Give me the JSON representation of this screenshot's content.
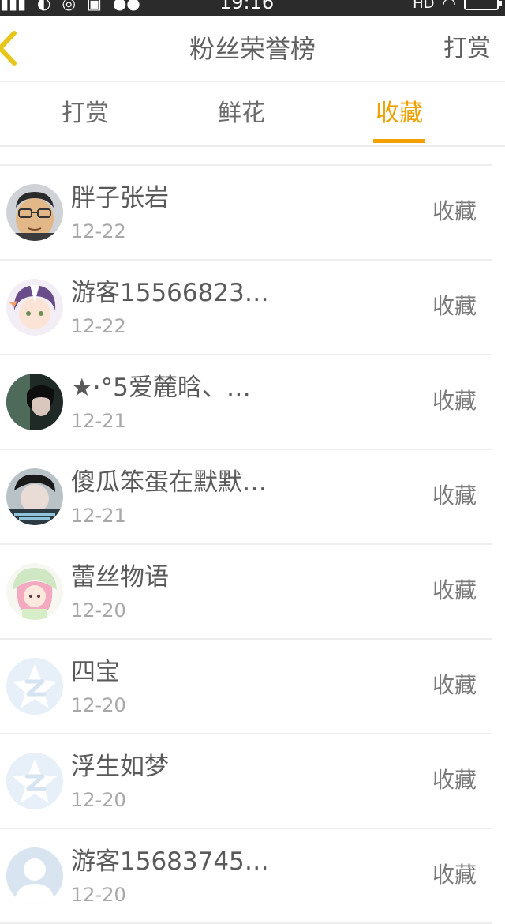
{
  "status_bar": {
    "time": "19:16",
    "network_label": "HD",
    "left_icons": [
      "signal-icon",
      "moon-icon",
      "location-icon",
      "sim-icon",
      "wechat-icon"
    ],
    "right_icons": [
      "wifi-icon",
      "battery-icon"
    ]
  },
  "navbar": {
    "title": "粉丝荣誉榜",
    "right_label": "打赏",
    "back_icon": "chevron-left-icon"
  },
  "tabs": [
    {
      "label": "打赏",
      "active": false
    },
    {
      "label": "鲜花",
      "active": false
    },
    {
      "label": "收藏",
      "active": true
    }
  ],
  "accent_color": "#f2a100",
  "list": [
    {
      "name": "胖子张岩",
      "date": "12-22",
      "action": "收藏",
      "avatar": "photo-avatar"
    },
    {
      "name": "游客15566823…",
      "date": "12-22",
      "action": "收藏",
      "avatar": "anime-avatar"
    },
    {
      "name": "★·°5爱麓晗、…",
      "date": "12-21",
      "action": "收藏",
      "avatar": "photo-avatar"
    },
    {
      "name": "傻瓜笨蛋在默默…",
      "date": "12-21",
      "action": "收藏",
      "avatar": "photo-avatar"
    },
    {
      "name": "蕾丝物语",
      "date": "12-20",
      "action": "收藏",
      "avatar": "anime-avatar"
    },
    {
      "name": "四宝",
      "date": "12-20",
      "action": "收藏",
      "avatar": "qq-default-avatar"
    },
    {
      "name": "浮生如梦",
      "date": "12-20",
      "action": "收藏",
      "avatar": "qq-default-avatar"
    },
    {
      "name": "游客15683745…",
      "date": "12-20",
      "action": "收藏",
      "avatar": "silhouette-avatar"
    }
  ]
}
